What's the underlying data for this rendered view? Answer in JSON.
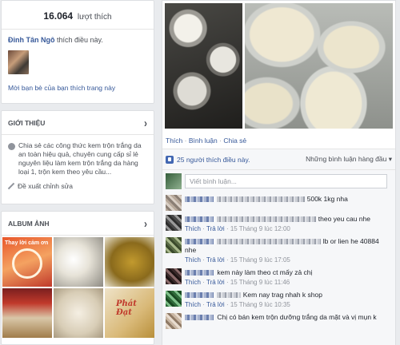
{
  "likes_card": {
    "count": "16.064",
    "count_label": "lượt thích",
    "liker_name": "Đinh Tân Ngô",
    "liker_text": "thích điều này.",
    "invite_text": "Mời bạn bè của bạn thích trang này"
  },
  "intro_card": {
    "header": "GIỚI THIỆU",
    "text": "Chia sẻ các công thức kem trộn trắng da an toàn hiệu quả, chuyên cung cấp sỉ lẻ nguyên liệu làm kem trộn trắng da hàng loại 1, trộn kem theo yêu cầu...",
    "suggest_label": "Đề xuất chỉnh sửa"
  },
  "album_card": {
    "header": "ALBUM ẢNH",
    "thumb1_text": "Thay lời cảm ơn",
    "thumb6_text": "Phát Đạt"
  },
  "post": {
    "actions": [
      "Thích",
      "Bình luận",
      "Chia sẻ"
    ],
    "likes_text": "25 người thích điều này.",
    "sort_label": "Những bình luận hàng đầu",
    "write_placeholder": "Viết bình luận..."
  },
  "comments": [
    {
      "text": "500k 1kg nha",
      "meta_like": "",
      "meta_reply": "",
      "time": ""
    },
    {
      "text": "theo yeu cau nhe",
      "meta_like": "Thích",
      "meta_reply": "Trả lời",
      "time": "15 Tháng 9 lúc 12:00"
    },
    {
      "text": "lb or lien he 40884 nhe",
      "meta_like": "Thích",
      "meta_reply": "Trả lời",
      "time": "15 Tháng 9 lúc 17:05"
    },
    {
      "text": "kem này làm theo ct mấy zả chị",
      "meta_like": "Thích",
      "meta_reply": "Trả lời",
      "time": "15 Tháng 9 lúc 11:46"
    },
    {
      "text": "Kem nay trag nhah k shop",
      "meta_like": "Thích",
      "meta_reply": "Trả lời",
      "time": "15 Tháng 9 lúc 10:35"
    },
    {
      "text": "Chị có bán kem trộn dưỡng trắng da mặt và vị mụn k",
      "meta_like": "",
      "meta_reply": "",
      "time": ""
    }
  ],
  "colors": {
    "link": "#365899",
    "page_bg": "#e9ebee",
    "fb_blue": "#4267b2"
  }
}
